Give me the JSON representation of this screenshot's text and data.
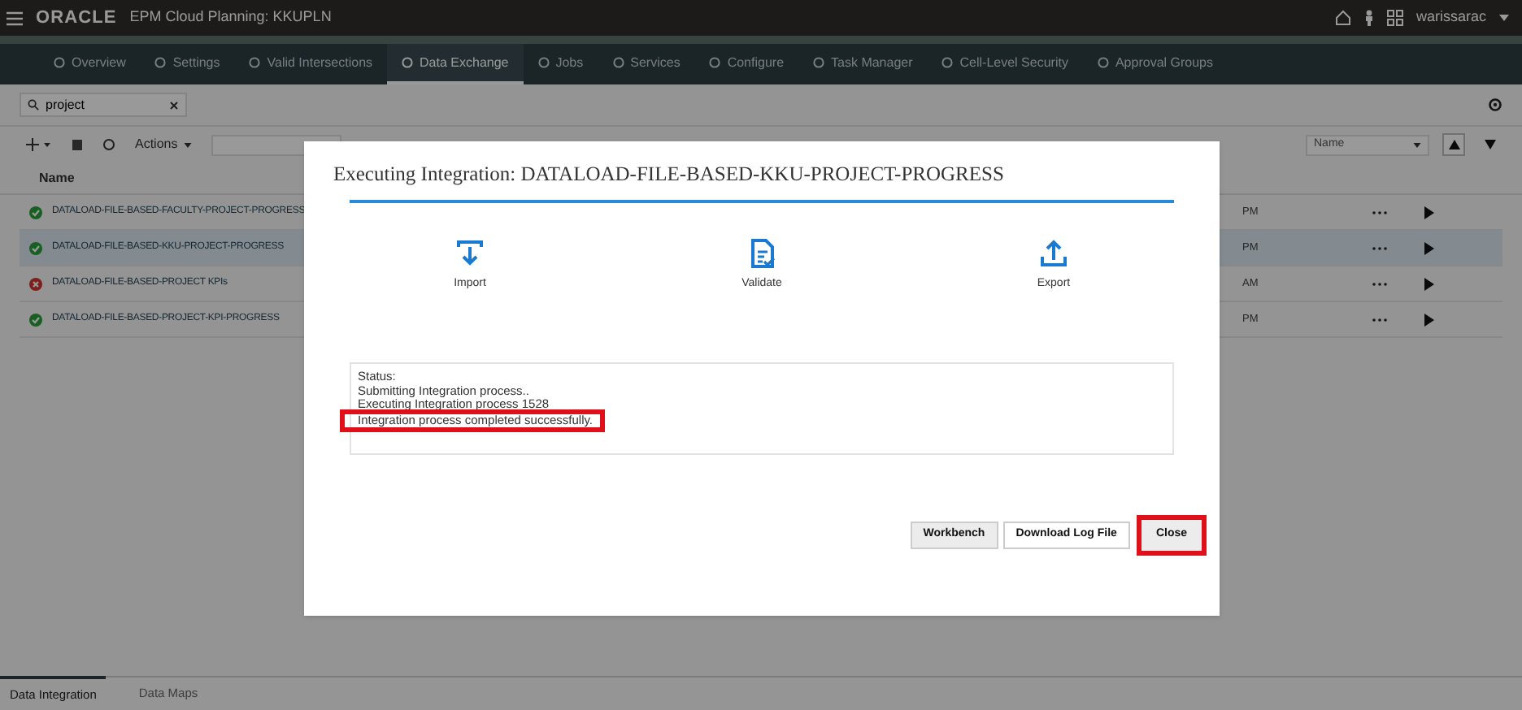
{
  "header": {
    "brand": "ORACLE",
    "app_title": "EPM Cloud Planning: KKUPLN",
    "user": "warissarac"
  },
  "nav_tabs": [
    {
      "label": "Overview",
      "selected": false
    },
    {
      "label": "Settings",
      "selected": false
    },
    {
      "label": "Valid Intersections",
      "selected": false
    },
    {
      "label": "Data Exchange",
      "selected": true
    },
    {
      "label": "Jobs",
      "selected": false
    },
    {
      "label": "Services",
      "selected": false
    },
    {
      "label": "Configure",
      "selected": false
    },
    {
      "label": "Task Manager",
      "selected": false
    },
    {
      "label": "Cell-Level Security",
      "selected": false
    },
    {
      "label": "Approval Groups",
      "selected": false
    }
  ],
  "search": {
    "value": "project"
  },
  "toolbar": {
    "actions": "Actions",
    "sort_field": "Name"
  },
  "table": {
    "columns": [
      "Name"
    ],
    "rows": [
      {
        "name": "DATALOAD-FILE-BASED-FACULTY-PROJECT-PROGRESS",
        "failed": false,
        "time": "PM",
        "selected": false
      },
      {
        "name": "DATALOAD-FILE-BASED-KKU-PROJECT-PROGRESS",
        "failed": false,
        "time": "PM",
        "selected": true
      },
      {
        "name": "DATALOAD-FILE-BASED-PROJECT KPIs",
        "failed": true,
        "time": "AM",
        "selected": false
      },
      {
        "name": "DATALOAD-FILE-BASED-PROJECT-KPI-PROGRESS",
        "failed": false,
        "time": "PM",
        "selected": false
      }
    ]
  },
  "bottom_tabs": [
    {
      "label": "Data Integration",
      "selected": true
    },
    {
      "label": "Data Maps",
      "selected": false
    }
  ],
  "dialog": {
    "title": "Executing Integration: DATALOAD-FILE-BASED-KKU-PROJECT-PROGRESS",
    "steps": [
      {
        "kind": "import",
        "label": "Import"
      },
      {
        "kind": "validate",
        "label": "Validate"
      },
      {
        "kind": "export",
        "label": "Export"
      }
    ],
    "status_lines": [
      {
        "text": "Status:",
        "highlighted": false
      },
      {
        "text": "Submitting Integration process..",
        "highlighted": false
      },
      {
        "text": "Executing Integration process 1528",
        "highlighted": false
      },
      {
        "text": "Integration process completed successfully.",
        "highlighted": true
      }
    ],
    "buttons": [
      {
        "label": "Workbench",
        "highlighted": false,
        "shaded": true
      },
      {
        "label": "Download Log File",
        "highlighted": false,
        "shaded": false
      },
      {
        "label": "Close",
        "highlighted": true,
        "shaded": true
      }
    ]
  }
}
